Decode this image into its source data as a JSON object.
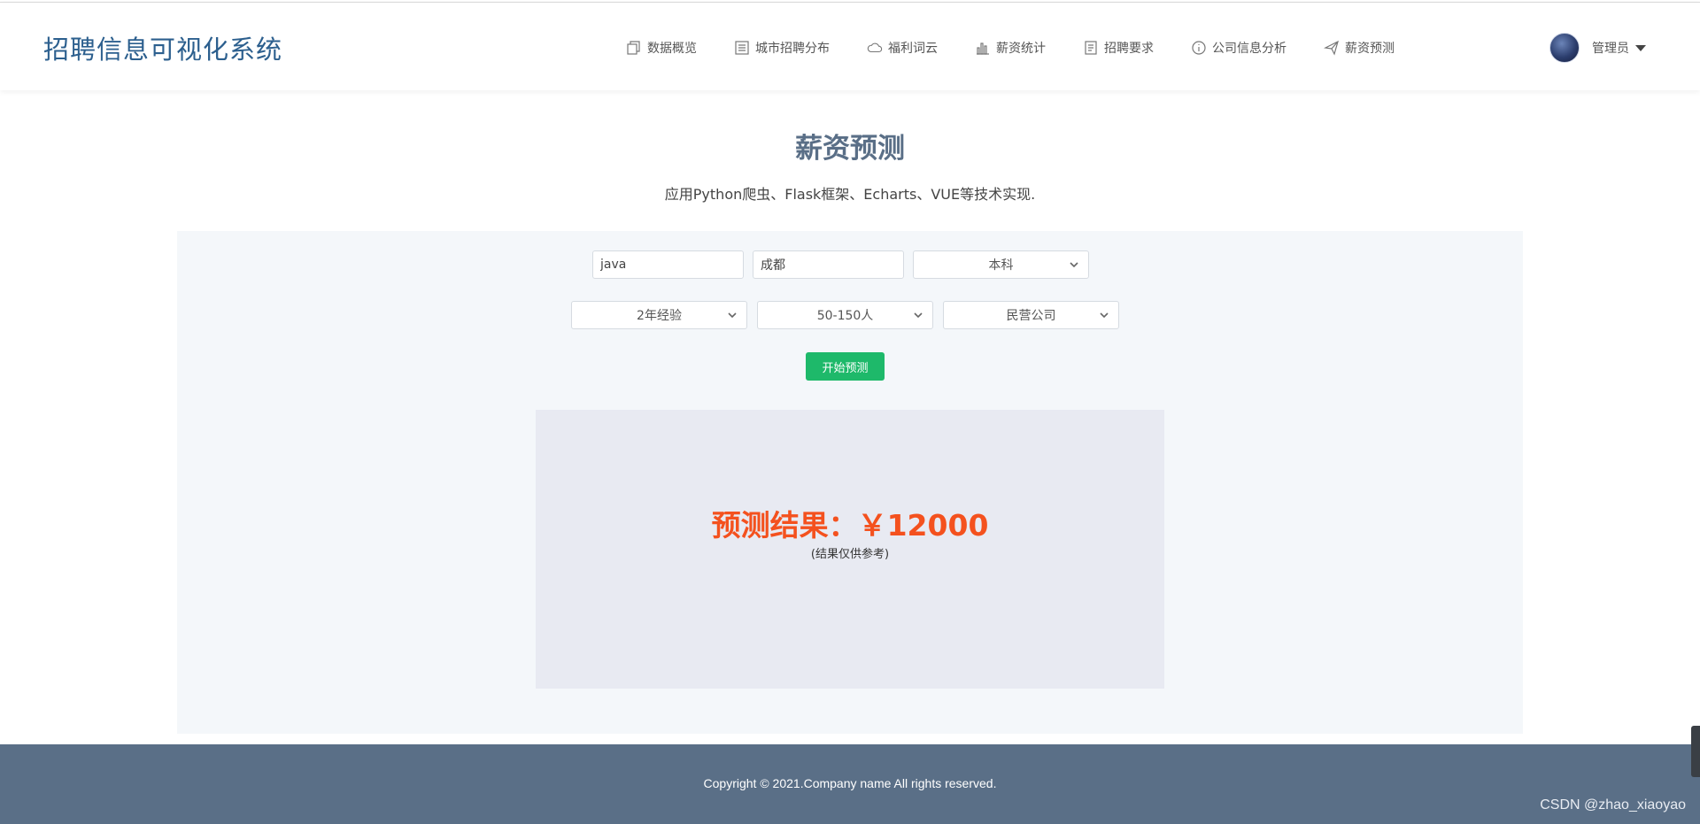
{
  "header": {
    "brand": "招聘信息可视化系统",
    "nav": [
      {
        "label": "数据概览",
        "icon": "copy-icon"
      },
      {
        "label": "城市招聘分布",
        "icon": "list-icon"
      },
      {
        "label": "福利词云",
        "icon": "cloud-icon"
      },
      {
        "label": "薪资统计",
        "icon": "bar-chart-icon"
      },
      {
        "label": "招聘要求",
        "icon": "document-icon"
      },
      {
        "label": "公司信息分析",
        "icon": "info-icon"
      },
      {
        "label": "薪资预测",
        "icon": "paper-plane-icon"
      }
    ],
    "user": {
      "name": "管理员",
      "avatar_icon": "avatar"
    }
  },
  "page": {
    "title": "薪资预测",
    "subtitle": "应用Python爬虫、Flask框架、Echarts、VUE等技术实现."
  },
  "form": {
    "job_value": "java",
    "city_value": "成都",
    "education": "本科",
    "experience": "2年经验",
    "company_size": "50-150人",
    "company_type": "民营公司",
    "submit_label": "开始预测"
  },
  "result": {
    "main": "预测结果：￥12000",
    "note": "(结果仅供参考)"
  },
  "footer": {
    "copyright": "Copyright © 2021.Company name All rights reserved.",
    "watermark": "CSDN @zhao_xiaoyao"
  },
  "colors": {
    "brand": "#2c5f8e",
    "title": "#5a6f87",
    "button": "#1eb96a",
    "result": "#f4511e",
    "footer": "#5a6f87"
  }
}
